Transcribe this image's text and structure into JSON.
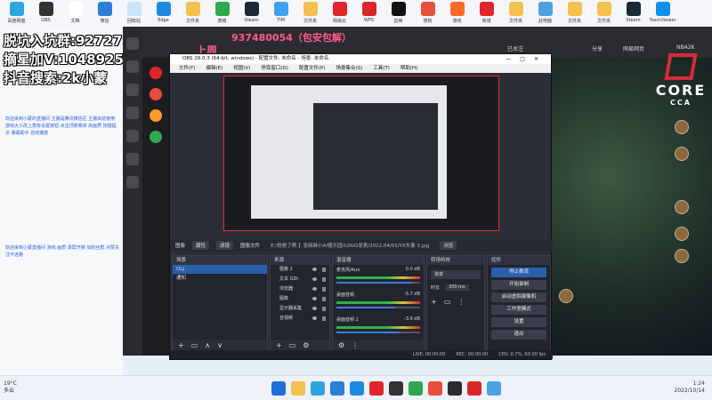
{
  "desktop": {
    "icons": [
      {
        "label": "百度网盘",
        "color": "#2fa5e0"
      },
      {
        "label": "OBS",
        "color": "#333333"
      },
      {
        "label": "文档",
        "color": "#ffffff"
      },
      {
        "label": "微信",
        "color": "#2a7fd9"
      },
      {
        "label": "回收站",
        "color": "#cce4f7"
      },
      {
        "label": "Edge",
        "color": "#1f8be0"
      },
      {
        "label": "文件夹",
        "color": "#f2c14e"
      },
      {
        "label": "表格",
        "color": "#2fa84f"
      },
      {
        "label": "Steam",
        "color": "#1b2838"
      },
      {
        "label": "TIM",
        "color": "#40a0f0"
      },
      {
        "label": "文件夹",
        "color": "#f2c14e"
      },
      {
        "label": "网易云",
        "color": "#e0262b"
      },
      {
        "label": "WPS",
        "color": "#d9262b"
      },
      {
        "label": "剪映",
        "color": "#111111"
      },
      {
        "label": "搜狗",
        "color": "#e84d3d"
      },
      {
        "label": "游戏",
        "color": "#ff6a2a"
      },
      {
        "label": "商城",
        "color": "#e0262b"
      },
      {
        "label": "文件夹",
        "color": "#f2c14e"
      },
      {
        "label": "此电脑",
        "color": "#4aa3e0"
      },
      {
        "label": "文件夹",
        "color": "#f2c14e"
      },
      {
        "label": "文件夹",
        "color": "#f2c14e"
      },
      {
        "label": "Steam",
        "color": "#1b2838"
      },
      {
        "label": "TeamViewer",
        "color": "#0e8ee9"
      }
    ],
    "overlay": [
      "脱坑入坑群:927271553",
      "摘星加V:1048925880",
      "抖音搜索:2k小蒙"
    ],
    "note1": "欢迎来到小蒙的直播间 主播是腾讯微信区 主播目前使用游戏大小改上角有设置按钮 点击顶部菜单 高画质 按键提示 弹幕助手 自动播放",
    "note2": "欢迎来到小蒙直播间 游戏 画质 录屏开播 加粉丝群 点赞关注不迷路"
  },
  "browser": {
    "stream_title": "上周",
    "overlay_qq": "937480054（包安包解）",
    "top_right": [
      "已关注",
      "分享",
      "网易网页",
      "NBA2K"
    ],
    "brand_text": "CORE",
    "brand_sub": "CCA"
  },
  "obs": {
    "title": "OBS 28.0.3 (64-bit, windows) - 配置文件: 未命名 - 场景: 未命名",
    "menu": [
      "文件(F)",
      "编辑(E)",
      "视图(V)",
      "停靠窗口(D)",
      "配置文件(P)",
      "场景集合(S)",
      "工具(T)",
      "帮助(H)"
    ],
    "toolbar": {
      "image": "图像",
      "props": "属性",
      "filters": "滤镜",
      "image_file": "图像文件",
      "file_path": "E:/抢救了啊 】张麻麻小A/暖乐园/LOGO发表/2022.04/01/YX头像 3.jpg",
      "browse": "浏览"
    },
    "docks": {
      "scenes": {
        "title": "场景",
        "items": [
          "OLJ",
          "通知"
        ]
      },
      "sources": {
        "title": "来源",
        "items": [
          "图像 2",
          "文本 GDI",
          "浏览器",
          "图像",
          "显示器采集",
          "音视频"
        ]
      },
      "mixer": {
        "title": "混音器",
        "channels": [
          {
            "name": "麦克风/Aux",
            "db": "0.0 dB",
            "level": 0.9
          },
          {
            "name": "桌面音频",
            "db": "-5.7 dB",
            "level": 0.7
          },
          {
            "name": "桌面音频 2",
            "db": "-3.9 dB",
            "level": 0.75
          }
        ]
      },
      "transitions": {
        "title": "转场特效",
        "type": "渐变",
        "duration_label": "时长",
        "duration": "300 ms"
      },
      "controls": {
        "title": "控件",
        "buttons": [
          "停止推流",
          "开始录制",
          "启动虚拟摄像机",
          "工作室模式",
          "设置",
          "退出"
        ]
      }
    },
    "status": {
      "live": "LIVE: 00:00:00",
      "rec": "REC: 00:00:00",
      "cpu": "CPU: 0.7%, 60.00 fps"
    }
  },
  "taskbar": {
    "weather": "19°C",
    "weather_desc": "多云",
    "time": "1:24",
    "date": "2022/10/14",
    "apps": [
      "#1e6fd9",
      "#f2c14e",
      "#2fa5e0",
      "#2a7fd9",
      "#1f8be0",
      "#e0262b",
      "#333333",
      "#2fa84f",
      "#e84d3d",
      "#2b2b30",
      "#d9262b",
      "#4aa3e0"
    ]
  }
}
